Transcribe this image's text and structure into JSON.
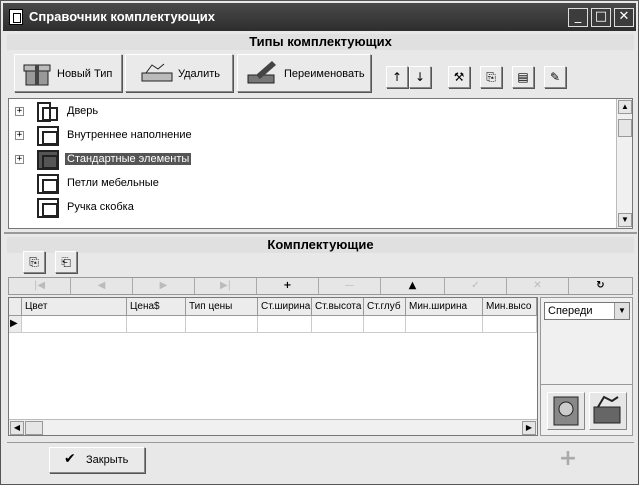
{
  "window": {
    "title": "Справочник комплектующих"
  },
  "types": {
    "section_title": "Типы комплектующих",
    "toolbar": {
      "new": "Новый Тип",
      "delete": "Удалить",
      "rename": "Переименовать"
    },
    "tree": [
      {
        "label": "Дверь",
        "expandable": true,
        "selected": false
      },
      {
        "label": "Внутреннее наполнение",
        "expandable": true,
        "selected": false
      },
      {
        "label": "Стандартные элементы",
        "expandable": true,
        "selected": true
      },
      {
        "label": "Петли мебельные",
        "expandable": false,
        "selected": false
      },
      {
        "label": "Ручка скобка",
        "expandable": false,
        "selected": false
      }
    ]
  },
  "components": {
    "section_title": "Комплектующие",
    "columns": [
      "Цвет",
      "Цена$",
      "Тип цены",
      "Ст.ширина",
      "Ст.высота",
      "Ст.глуб",
      "Мин.ширина",
      "Мин.высо"
    ],
    "view_select": "Спереди"
  },
  "footer": {
    "close": "Закрыть"
  }
}
